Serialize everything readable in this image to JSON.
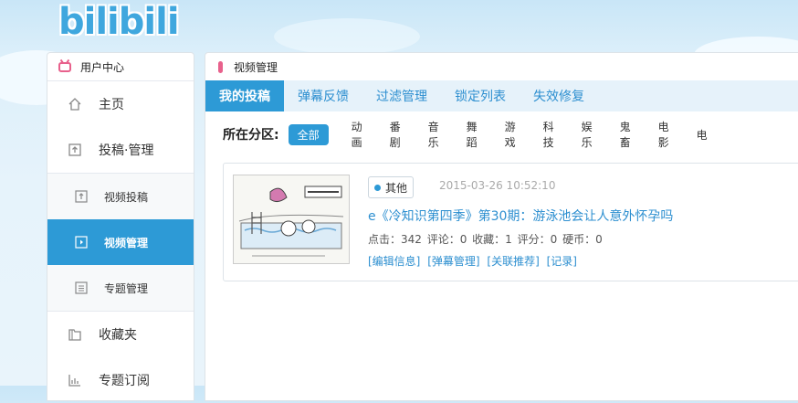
{
  "logo": {
    "text": "bilibili"
  },
  "sidebar": {
    "header": "用户中心",
    "items": [
      {
        "label": "主页",
        "icon": "home-icon"
      },
      {
        "label": "投稿·管理",
        "icon": "upload-icon"
      }
    ],
    "subitems": [
      {
        "label": "视频投稿",
        "icon": "upload-box-icon"
      },
      {
        "label": "视频管理",
        "icon": "video-icon",
        "active": true
      },
      {
        "label": "专题管理",
        "icon": "list-icon"
      }
    ],
    "bottom": [
      {
        "label": "收藏夹",
        "icon": "folder-icon"
      },
      {
        "label": "专题订阅",
        "icon": "chart-icon"
      }
    ]
  },
  "main": {
    "header": "视频管理",
    "tabs": [
      "我的投稿",
      "弹幕反馈",
      "过滤管理",
      "锁定列表",
      "失效修复"
    ],
    "active_tab": "我的投稿",
    "filter": {
      "label": "所在分区:",
      "options": [
        "全部",
        "动画",
        "番剧",
        "音乐",
        "舞蹈",
        "游戏",
        "科技",
        "娱乐",
        "鬼畜",
        "电影",
        "电"
      ],
      "active": "全部"
    },
    "video": {
      "category": "其他",
      "date": "2015-03-26 10:52:10",
      "title": "e《冷知识第四季》第30期：游泳池会让人意外怀孕吗",
      "stats": "点击：342  评论：0  收藏：1  评分：0  硬币：0",
      "actions": [
        "[编辑信息]",
        "[弹幕管理]",
        "[关联推荐]",
        "[记录]"
      ]
    }
  },
  "colors": {
    "accent": "#2d9ad6",
    "pink": "#e8618c",
    "tab_bg": "#e6f2fa"
  }
}
